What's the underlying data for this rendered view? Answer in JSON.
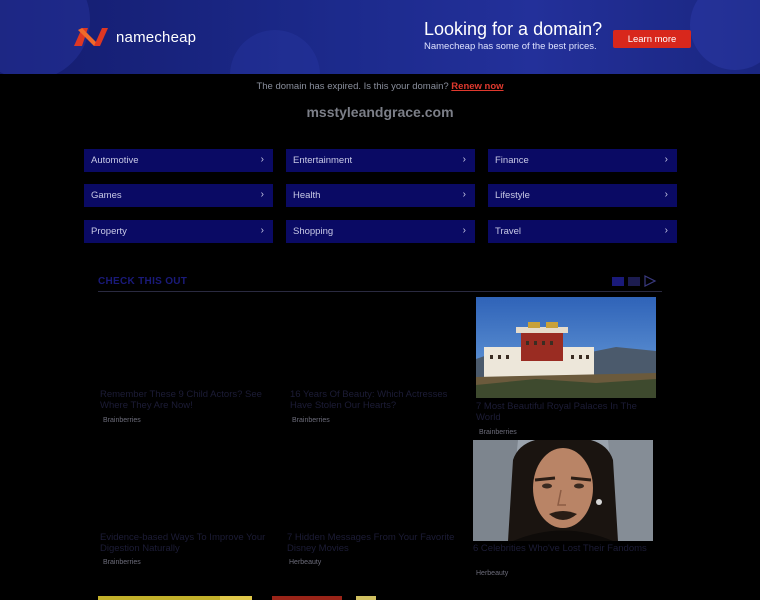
{
  "banner": {
    "brand": "namecheap",
    "title": "Looking for a domain?",
    "subtitle": "Namecheap has some of the best prices.",
    "button": "Learn more",
    "brand_color": "#de3723"
  },
  "notice": {
    "text": "The domain has expired. Is this your domain?",
    "link": "Renew now"
  },
  "domain": "msstyleandgrace.com",
  "categories": [
    "Automotive",
    "Entertainment",
    "Finance",
    "Games",
    "Health",
    "Lifestyle",
    "Property",
    "Shopping",
    "Travel"
  ],
  "chevron_icon": "chevron-right-icon",
  "feed": {
    "heading": "CHECK THIS OUT",
    "cards": [
      {
        "title": "Remember These 9 Child Actors? See Where They Are Now!",
        "source": "Brainberries"
      },
      {
        "title": "16 Years Of Beauty: Which Actresses Have Stolen Our Hearts?",
        "source": "Brainberries"
      },
      {
        "title": "7 Most Beautiful Royal Palaces In The World",
        "source": "Brainberries"
      },
      {
        "title": "Evidence-based Ways To Improve Your Digestion Naturally",
        "source": "Brainberries"
      },
      {
        "title": "7 Hidden Messages From Your Favorite Disney Movies",
        "source": "Herbeauty"
      },
      {
        "title": "6 Celebrities Who've Lost Their Fandoms",
        "source": "Herbeauty"
      }
    ]
  }
}
